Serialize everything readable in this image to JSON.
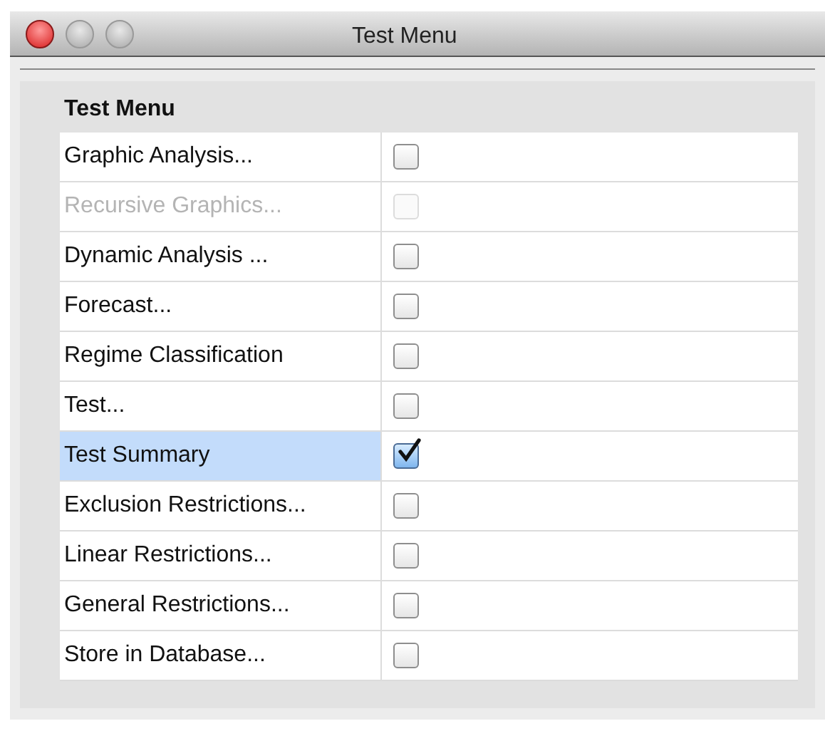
{
  "window": {
    "title": "Test Menu"
  },
  "panel": {
    "heading": "Test Menu",
    "rows": [
      {
        "label": "Graphic Analysis...",
        "checked": false,
        "disabled": false,
        "selected": false
      },
      {
        "label": "Recursive Graphics...",
        "checked": false,
        "disabled": true,
        "selected": false
      },
      {
        "label": "Dynamic Analysis ...",
        "checked": false,
        "disabled": false,
        "selected": false
      },
      {
        "label": "Forecast...",
        "checked": false,
        "disabled": false,
        "selected": false
      },
      {
        "label": "Regime Classification",
        "checked": false,
        "disabled": false,
        "selected": false
      },
      {
        "label": "Test...",
        "checked": false,
        "disabled": false,
        "selected": false
      },
      {
        "label": "Test Summary",
        "checked": true,
        "disabled": false,
        "selected": true
      },
      {
        "label": "Exclusion Restrictions...",
        "checked": false,
        "disabled": false,
        "selected": false
      },
      {
        "label": "Linear Restrictions...",
        "checked": false,
        "disabled": false,
        "selected": false
      },
      {
        "label": "General Restrictions...",
        "checked": false,
        "disabled": false,
        "selected": false
      },
      {
        "label": "Store in Database...",
        "checked": false,
        "disabled": false,
        "selected": false
      }
    ]
  }
}
